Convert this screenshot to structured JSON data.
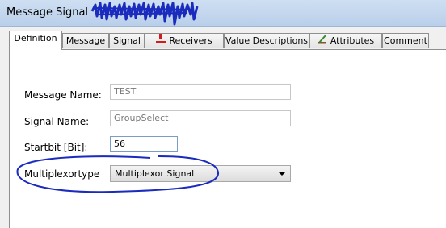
{
  "window": {
    "title": "Message Signal"
  },
  "tabs": [
    {
      "label": "Definition",
      "icon": null
    },
    {
      "label": "Message",
      "icon": null
    },
    {
      "label": "Signal",
      "icon": null
    },
    {
      "label": "Receivers",
      "icon": "receiver-icon"
    },
    {
      "label": "Value Descriptions",
      "icon": null
    },
    {
      "label": "Attributes",
      "icon": "attributes-icon"
    },
    {
      "label": "Comment",
      "icon": null
    }
  ],
  "form": {
    "message_name_label": "Message Name:",
    "message_name_value": "TEST",
    "signal_name_label": "Signal Name:",
    "signal_name_value": "GroupSelect",
    "startbit_label": "Startbit [Bit]:",
    "startbit_value": "56",
    "multiplexortype_label": "Multiplexortype",
    "multiplexortype_value": "Multiplexor Signal"
  },
  "colors": {
    "annotation_ink": "#1a2bbd",
    "receiver_icon": "#d21b1b",
    "attributes_icon": "#3a8a2f"
  }
}
